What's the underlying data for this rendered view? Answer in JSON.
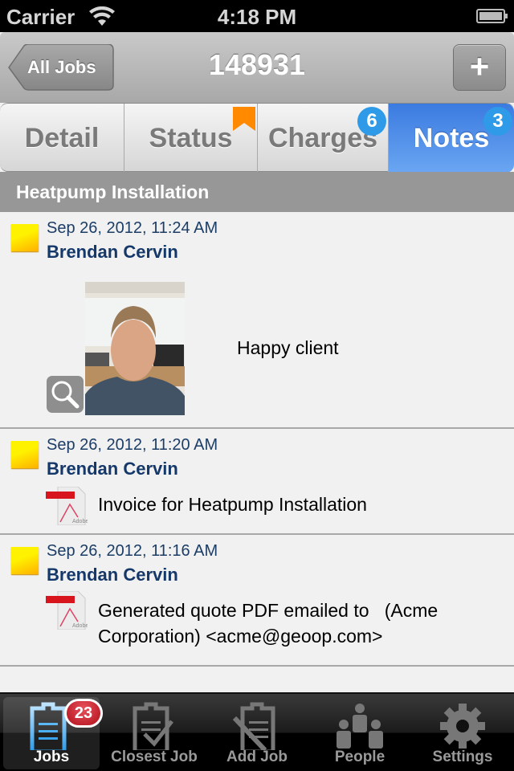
{
  "status_bar": {
    "carrier": "Carrier",
    "time": "4:18 PM",
    "icons": [
      "wifi-icon",
      "battery-icon"
    ]
  },
  "nav_bar": {
    "back_label": "All Jobs",
    "title": "148931",
    "add_label": "+"
  },
  "segments": [
    {
      "label": "Detail",
      "selected": false
    },
    {
      "label": "Status",
      "selected": false,
      "flag": true
    },
    {
      "label": "Charges",
      "selected": false,
      "badge": "6"
    },
    {
      "label": "Notes",
      "selected": true,
      "badge": "3"
    }
  ],
  "colors": {
    "selected_segment": "#3b7be0",
    "badge_blue": "#2f9be8",
    "flag_orange": "#ff8a00",
    "author_blue": "#14386a",
    "tab_badge_red": "#c8141f"
  },
  "section": {
    "title": "Heatpump Installation"
  },
  "notes": [
    {
      "date": "Sep 26, 2012, 11:24 AM",
      "author": "Brendan Cervin",
      "attachment": "photo",
      "text": "Happy client"
    },
    {
      "date": "Sep 26, 2012, 11:20 AM",
      "author": "Brendan Cervin",
      "attachment": "pdf",
      "text": "Invoice for Heatpump Installation"
    },
    {
      "date": "Sep 26, 2012, 11:16 AM",
      "author": "Brendan Cervin",
      "attachment": "pdf",
      "text_line1": "Generated quote PDF emailed to   (Acme",
      "text_line2": "Corporation) <acme@geoop.com>"
    }
  ],
  "tab_bar": {
    "tabs": [
      {
        "label": "Jobs",
        "icon": "clipboard-icon",
        "active": true,
        "badge": "23"
      },
      {
        "label": "Closest Job",
        "icon": "clipboard-check-icon",
        "active": false
      },
      {
        "label": "Add Job",
        "icon": "clipboard-pencil-icon",
        "active": false
      },
      {
        "label": "People",
        "icon": "people-icon",
        "active": false
      },
      {
        "label": "Settings",
        "icon": "gear-icon",
        "active": false
      }
    ]
  }
}
